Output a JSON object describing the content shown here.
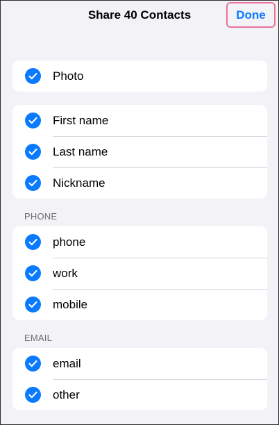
{
  "nav": {
    "title": "Share 40 Contacts",
    "done_label": "Done"
  },
  "groups": {
    "photo": {
      "items": [
        {
          "label": "Photo",
          "checked": true
        }
      ]
    },
    "name": {
      "items": [
        {
          "label": "First name",
          "checked": true
        },
        {
          "label": "Last name",
          "checked": true
        },
        {
          "label": "Nickname",
          "checked": true
        }
      ]
    },
    "phone": {
      "header": "PHONE",
      "items": [
        {
          "label": "phone",
          "checked": true
        },
        {
          "label": "work",
          "checked": true
        },
        {
          "label": "mobile",
          "checked": true
        }
      ]
    },
    "email": {
      "header": "EMAIL",
      "items": [
        {
          "label": "email",
          "checked": true
        },
        {
          "label": "other",
          "checked": true
        }
      ]
    }
  },
  "colors": {
    "accent": "#0a7aff",
    "background": "#f2f2f7",
    "highlight_border": "#e8739a"
  },
  "icons": {
    "checkmark": "checkmark-circle-fill-icon"
  }
}
